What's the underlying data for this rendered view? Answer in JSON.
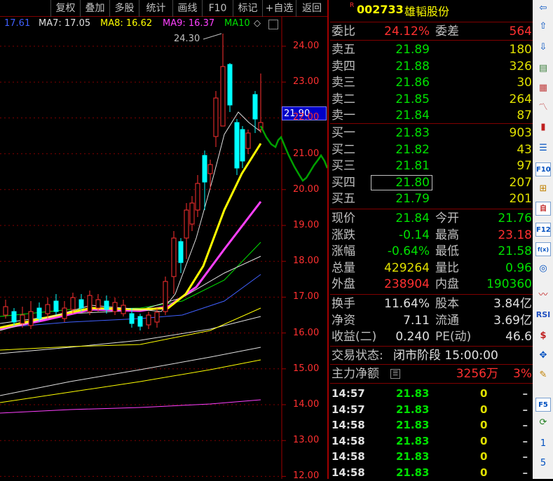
{
  "toolbar": {
    "buttons": [
      "复权",
      "叠加",
      "多股",
      "统计",
      "画线",
      "F10",
      "标记",
      "+自选",
      "返回"
    ]
  },
  "chart": {
    "ma_legend": [
      {
        "label": "17.61",
        "color": "#4060ff"
      },
      {
        "label": "MA7: 17.05",
        "color": "#e0e0e0"
      },
      {
        "label": "MA8: 16.62",
        "color": "#ffff00"
      },
      {
        "label": "MA9: 16.37",
        "color": "#ff40ff"
      },
      {
        "label": "MA10",
        "color": "#00e000"
      }
    ],
    "peak_label": "24.30",
    "current_price_tag": "21.90",
    "y_ticks": [
      "24.00",
      "23.00",
      "22.00",
      "21.00",
      "20.00",
      "19.00",
      "18.00",
      "17.00",
      "16.00",
      "15.00",
      "14.00",
      "13.00",
      "12.00"
    ],
    "colors": {
      "up": "#ff3030",
      "down": "#00ffff",
      "ma_fast": "#ffff00",
      "ma_mid": "#ff40ff",
      "annotation": "#00a000"
    }
  },
  "stock": {
    "marker": "R",
    "code": "002733",
    "name": "雄韬股份"
  },
  "weibi": {
    "label1": "委比",
    "val1": "24.12%",
    "label2": "委差",
    "val2": "564"
  },
  "asks": [
    {
      "label": "卖五",
      "price": "21.89",
      "vol": "180"
    },
    {
      "label": "卖四",
      "price": "21.88",
      "vol": "326"
    },
    {
      "label": "卖三",
      "price": "21.86",
      "vol": "30"
    },
    {
      "label": "卖二",
      "price": "21.85",
      "vol": "264"
    },
    {
      "label": "卖一",
      "price": "21.84",
      "vol": "87"
    }
  ],
  "bids": [
    {
      "label": "买一",
      "price": "21.83",
      "vol": "903"
    },
    {
      "label": "买二",
      "price": "21.82",
      "vol": "43"
    },
    {
      "label": "买三",
      "price": "21.81",
      "vol": "97"
    },
    {
      "label": "买四",
      "price": "21.80",
      "vol": "207"
    },
    {
      "label": "买五",
      "price": "21.79",
      "vol": "201"
    }
  ],
  "stats": [
    {
      "l1": "现价",
      "v1": "21.84",
      "c1": "green",
      "l2": "今开",
      "v2": "21.76",
      "c2": "green"
    },
    {
      "l1": "涨跌",
      "v1": "-0.14",
      "c1": "green",
      "l2": "最高",
      "v2": "23.18",
      "c2": "red"
    },
    {
      "l1": "涨幅",
      "v1": "-0.64%",
      "c1": "green",
      "l2": "最低",
      "v2": "21.58",
      "c2": "green"
    },
    {
      "l1": "总量",
      "v1": "429264",
      "c1": "yellow",
      "l2": "量比",
      "v2": "0.96",
      "c2": "green"
    },
    {
      "l1": "外盘",
      "v1": "238904",
      "c1": "red",
      "l2": "内盘",
      "v2": "190360",
      "c2": "green"
    }
  ],
  "fundamentals": [
    {
      "l1": "换手",
      "v1": "11.64%",
      "l2": "股本",
      "v2": "3.84亿"
    },
    {
      "l1": "净资",
      "v1": "7.11",
      "l2": "流通",
      "v2": "3.69亿"
    },
    {
      "l1": "收益(二)",
      "v1": "0.240",
      "l2": "PE(动)",
      "v2": "46.6"
    }
  ],
  "trade_status": {
    "label": "交易状态:",
    "value": "闭市阶段 15:00:00"
  },
  "main_flow": {
    "label": "主力净额",
    "value": "3256万",
    "pct": "3%"
  },
  "ticks": [
    {
      "time": "14:57",
      "price": "21.83",
      "vol": "0",
      "dir": "–"
    },
    {
      "time": "14:57",
      "price": "21.83",
      "vol": "0",
      "dir": "–"
    },
    {
      "time": "14:58",
      "price": "21.83",
      "vol": "0",
      "dir": "–"
    },
    {
      "time": "14:58",
      "price": "21.83",
      "vol": "0",
      "dir": "–"
    },
    {
      "time": "14:58",
      "price": "21.83",
      "vol": "0",
      "dir": "–"
    },
    {
      "time": "14:58",
      "price": "21.83",
      "vol": "0",
      "dir": "–"
    }
  ],
  "sidebar": {
    "icons": [
      "arrow-left-icon",
      "arrow-up-icon",
      "arrow-down-icon",
      "report-icon",
      "grid-icon",
      "line-chart-icon",
      "candle-icon",
      "list-icon",
      "f10-icon",
      "hierarchy-icon",
      "self-select-icon",
      "f12-icon",
      "fx-icon",
      "circle-icon",
      "wave-icon",
      "rsi-icon",
      "dollar-icon",
      "move-icon",
      "pen-icon",
      "f5-icon",
      "refresh-icon"
    ],
    "labels": {
      "f10": "F10",
      "f12": "F12",
      "rsi": "RSI",
      "fx": "f(x)",
      "f5": "F5",
      "page1": "1",
      "page5": "5"
    }
  }
}
